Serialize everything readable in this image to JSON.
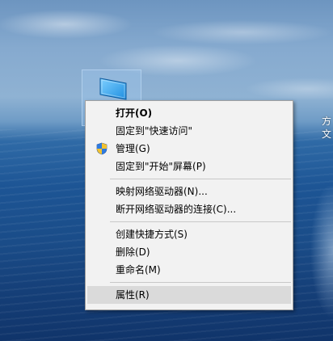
{
  "desktop": {
    "edge_text": [
      "方",
      "文"
    ],
    "icon": {
      "name": "monitor-icon"
    }
  },
  "context_menu": {
    "items": [
      {
        "label": "打开(O)",
        "default": true
      },
      {
        "label": "固定到\"快速访问\""
      },
      {
        "label": "管理(G)",
        "icon": "uac-shield-icon"
      },
      {
        "label": "固定到\"开始\"屏幕(P)"
      },
      {
        "label": "映射网络驱动器(N)..."
      },
      {
        "label": "断开网络驱动器的连接(C)..."
      },
      {
        "label": "创建快捷方式(S)"
      },
      {
        "label": "删除(D)"
      },
      {
        "label": "重命名(M)"
      },
      {
        "label": "属性(R)",
        "highlighted": true
      }
    ]
  },
  "colors": {
    "menu_background": "#f2f2f2",
    "menu_border": "#a0a0a0",
    "hover_background": "#dadada",
    "separator": "#c8c8c8"
  }
}
